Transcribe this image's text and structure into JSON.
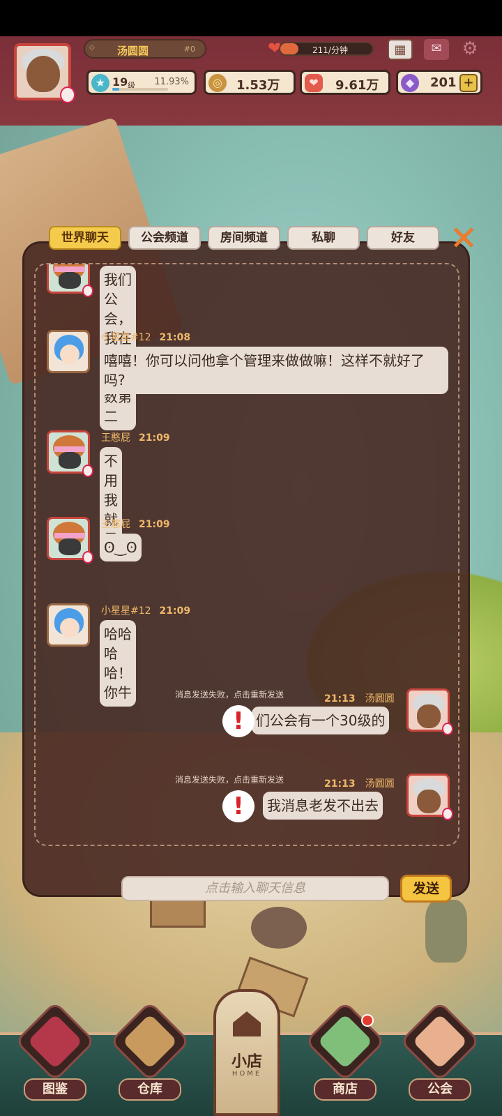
{
  "hud": {
    "player_name": "汤圆圆",
    "player_uid": "#0",
    "rate_text": "211/分钟",
    "rate_fill": 0.2,
    "level_value": "19",
    "level_suffix": "级",
    "level_percent": "11.93%",
    "level_progress": 0.1193,
    "coins": "1.53万",
    "hearts": "9.61万",
    "gems": "201",
    "gems_plus": "+"
  },
  "icons": {
    "calendar": "calendar-icon",
    "mail": "mail-icon",
    "settings": "gear-icon",
    "close": "close-icon"
  },
  "tabs": [
    {
      "label": "世界聊天",
      "active": true
    },
    {
      "label": "公会频道",
      "active": false
    },
    {
      "label": "房间频道",
      "active": false
    },
    {
      "label": "私聊",
      "active": false
    },
    {
      "label": "好友",
      "active": false
    }
  ],
  "close_label": "✕",
  "messages": [
    {
      "sender": "",
      "time": "",
      "text": "我们公会，我在里面排倒数第二"
    },
    {
      "sender": "小星星#12",
      "time": "21:08",
      "text": "嘻嘻！你可以问他拿个管理来做做嘛！这样不就好了吗?"
    },
    {
      "sender": "王憨屁",
      "time": "21:09",
      "text": "不用我就是"
    },
    {
      "sender": "王憨屁",
      "time": "21:09",
      "text": "ʘ‿ʘ"
    },
    {
      "sender": "小星星#12",
      "time": "21:09",
      "text": "哈哈哈哈！你牛"
    },
    {
      "sender": "汤圆圆",
      "time": "21:13",
      "text": "们公会有一个30级的",
      "failed": true,
      "fail_note": "消息发送失败，点击重新发送"
    },
    {
      "sender": "汤圆圆",
      "time": "21:13",
      "text": "我消息老发不出去",
      "failed": true,
      "fail_note": "消息发送失败，点击重新发送"
    }
  ],
  "fail_mark": "!",
  "input": {
    "placeholder": "点击输入聊天信息"
  },
  "send_label": "发送",
  "bottom_nav": {
    "codex": "图鉴",
    "warehouse": "仓库",
    "home": "小店",
    "home_sub": "HOME",
    "shop": "商店",
    "guild": "公会"
  },
  "colors": {
    "accent_tab": "#f5cb4d",
    "send_button": "#f5c441",
    "meta_text": "#f0b96a",
    "fail_red": "#d9232b"
  }
}
